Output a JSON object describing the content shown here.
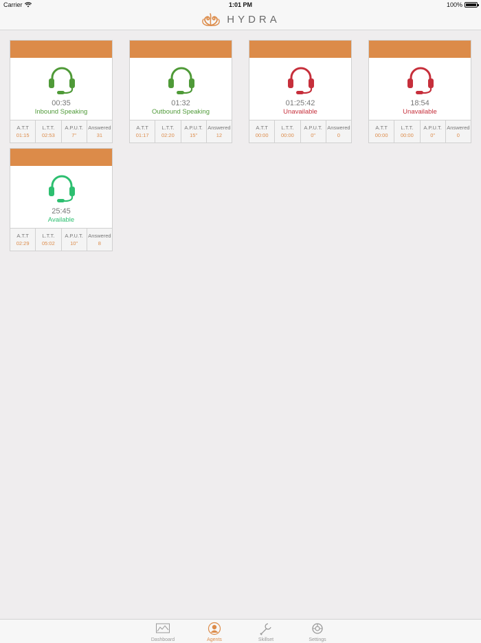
{
  "status_bar": {
    "carrier": "Carrier",
    "time": "1:01 PM",
    "battery": "100%"
  },
  "nav": {
    "brand": "HYDRA"
  },
  "colors": {
    "accent": "#dc8b49",
    "speaking": "#4f9a38",
    "unavailable": "#c62f3b",
    "available": "#2dbf70"
  },
  "stat_labels": {
    "att": "A.T.T",
    "ltt": "L.T.T.",
    "aput": "A.P.U.T.",
    "answered": "Answered"
  },
  "agents": [
    {
      "timer": "00:35",
      "status": "Inbound Speaking",
      "status_kind": "speaking",
      "att": "01:15",
      "ltt": "02:53",
      "aput": "7\"",
      "answered": "31"
    },
    {
      "timer": "01:32",
      "status": "Outbound Speaking",
      "status_kind": "speaking",
      "att": "01:17",
      "ltt": "02:20",
      "aput": "15\"",
      "answered": "12"
    },
    {
      "timer": "01:25:42",
      "status": "Unavailable",
      "status_kind": "unavailable",
      "att": "00:00",
      "ltt": "00:00",
      "aput": "0\"",
      "answered": "0"
    },
    {
      "timer": "18:54",
      "status": "Unavailable",
      "status_kind": "unavailable",
      "att": "00:00",
      "ltt": "00:00",
      "aput": "0\"",
      "answered": "0"
    },
    {
      "timer": "25:45",
      "status": "Available",
      "status_kind": "available",
      "att": "02:29",
      "ltt": "05:02",
      "aput": "10\"",
      "answered": "8"
    }
  ],
  "tabs": [
    {
      "label": "Dashboard",
      "icon": "chart-icon",
      "active": false
    },
    {
      "label": "Agents",
      "icon": "agent-icon",
      "active": true
    },
    {
      "label": "Skillset",
      "icon": "wrench-icon",
      "active": false
    },
    {
      "label": "Settings",
      "icon": "gear-icon",
      "active": false
    }
  ]
}
